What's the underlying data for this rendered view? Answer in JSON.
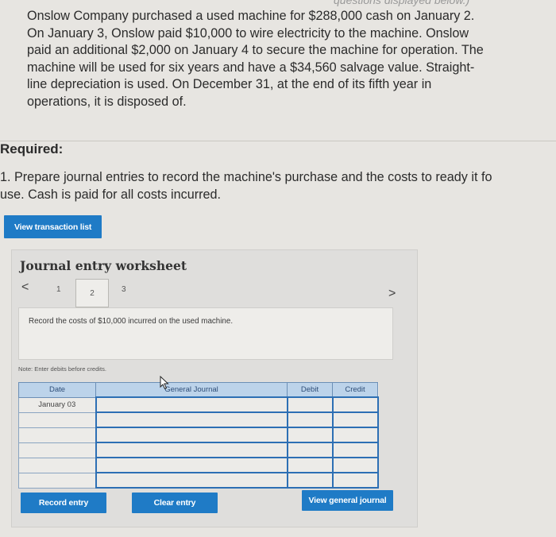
{
  "top_cutoff_text": "questions displayed below.)",
  "problem_lines": [
    "Onslow Company purchased a used machine for $288,000 cash on January 2.",
    "On January 3, Onslow paid $10,000 to wire electricity to the machine. Onslow",
    "paid an additional $2,000 on January 4 to secure the machine for operation. The",
    "machine will be used for six years and have a $34,560 salvage value. Straight-",
    "line depreciation is used. On December 31, at the end of its fifth year in",
    "operations, it is disposed of."
  ],
  "required": {
    "title": "Required:",
    "lines": [
      "1. Prepare journal entries to record the machine's purchase and the costs to ready it fo",
      "use. Cash is paid for all costs incurred."
    ]
  },
  "buttons": {
    "view_transaction_list": "View transaction list",
    "record_entry": "Record entry",
    "clear_entry": "Clear entry",
    "view_general_journal": "View general journal"
  },
  "worksheet": {
    "title": "Journal entry worksheet",
    "prev": "<",
    "next": ">",
    "steps": [
      "1",
      "2",
      "3"
    ],
    "active_step": "2",
    "instruction": "Record the costs of $10,000 incurred on the used machine.",
    "note": "Note: Enter debits before credits."
  },
  "journal": {
    "headers": {
      "date": "Date",
      "account": "General Journal",
      "debit": "Debit",
      "credit": "Credit"
    },
    "rows": [
      {
        "date": "January 03",
        "account": "",
        "debit": "",
        "credit": ""
      },
      {
        "date": "",
        "account": "",
        "debit": "",
        "credit": ""
      },
      {
        "date": "",
        "account": "",
        "debit": "",
        "credit": ""
      },
      {
        "date": "",
        "account": "",
        "debit": "",
        "credit": ""
      },
      {
        "date": "",
        "account": "",
        "debit": "",
        "credit": ""
      },
      {
        "date": "",
        "account": "",
        "debit": "",
        "credit": ""
      }
    ]
  },
  "colors": {
    "button_blue": "#1f7bc6",
    "header_blue": "#bcd3ea",
    "active_border": "#2d6fb4"
  },
  "icons": {
    "cursor": "mouse-pointer-icon"
  }
}
